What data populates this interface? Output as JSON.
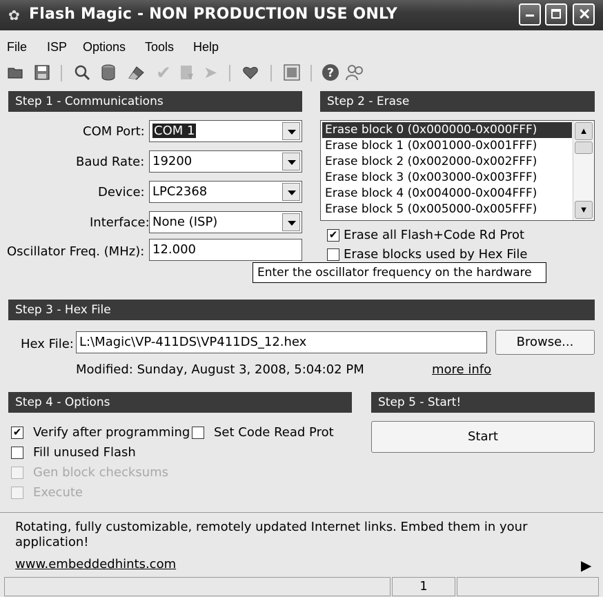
{
  "title": "Flash Magic - NON PRODUCTION USE ONLY",
  "menu": [
    "File",
    "ISP",
    "Options",
    "Tools",
    "Help"
  ],
  "step1": {
    "header": "Step 1 - Communications",
    "com_port_label": "COM Port:",
    "com_port_value": "COM 1",
    "baud_label": "Baud Rate:",
    "baud_value": "19200",
    "device_label": "Device:",
    "device_value": "LPC2368",
    "interface_label": "Interface:",
    "interface_value": "None (ISP)",
    "osc_label": "Oscillator Freq. (MHz):",
    "osc_value": "12.000"
  },
  "step2": {
    "header": "Step 2 - Erase",
    "blocks": [
      "Erase block 0 (0x000000-0x000FFF)",
      "Erase block 1 (0x001000-0x001FFF)",
      "Erase block 2 (0x002000-0x002FFF)",
      "Erase block 3 (0x003000-0x003FFF)",
      "Erase block 4 (0x004000-0x004FFF)",
      "Erase block 5 (0x005000-0x005FFF)"
    ],
    "erase_all_label": "Erase all Flash+Code Rd Prot",
    "erase_all_checked": true,
    "erase_hex_label": "Erase blocks used by Hex File",
    "erase_hex_checked": false
  },
  "tooltip": "Enter the oscillator frequency on the hardware",
  "step3": {
    "header": "Step 3 - Hex File",
    "hex_label": "Hex File:",
    "hex_value": "L:\\Magic\\VP-411DS\\VP411DS_12.hex",
    "browse": "Browse...",
    "modified": "Modified: Sunday, August 3, 2008, 5:04:02 PM",
    "more_info": "more info"
  },
  "step4": {
    "header": "Step 4 - Options",
    "verify": "Verify after programming",
    "set_code": "Set Code Read Prot",
    "fill_unused": "Fill unused Flash",
    "gen_block": "Gen block checksums",
    "execute": "Execute"
  },
  "step5": {
    "header": "Step 5 - Start!",
    "start": "Start"
  },
  "ad": {
    "text": "Rotating, fully customizable, remotely updated Internet links. Embed them in your application!",
    "link": "www.embeddedhints.com"
  },
  "status": {
    "panel2": "1"
  },
  "icons": [
    "open-icon",
    "save-icon",
    "search-icon",
    "database-icon",
    "erase-icon",
    "verify-icon",
    "program-icon",
    "next-icon",
    "heart-icon",
    "window-icon",
    "help-icon",
    "users-icon"
  ]
}
